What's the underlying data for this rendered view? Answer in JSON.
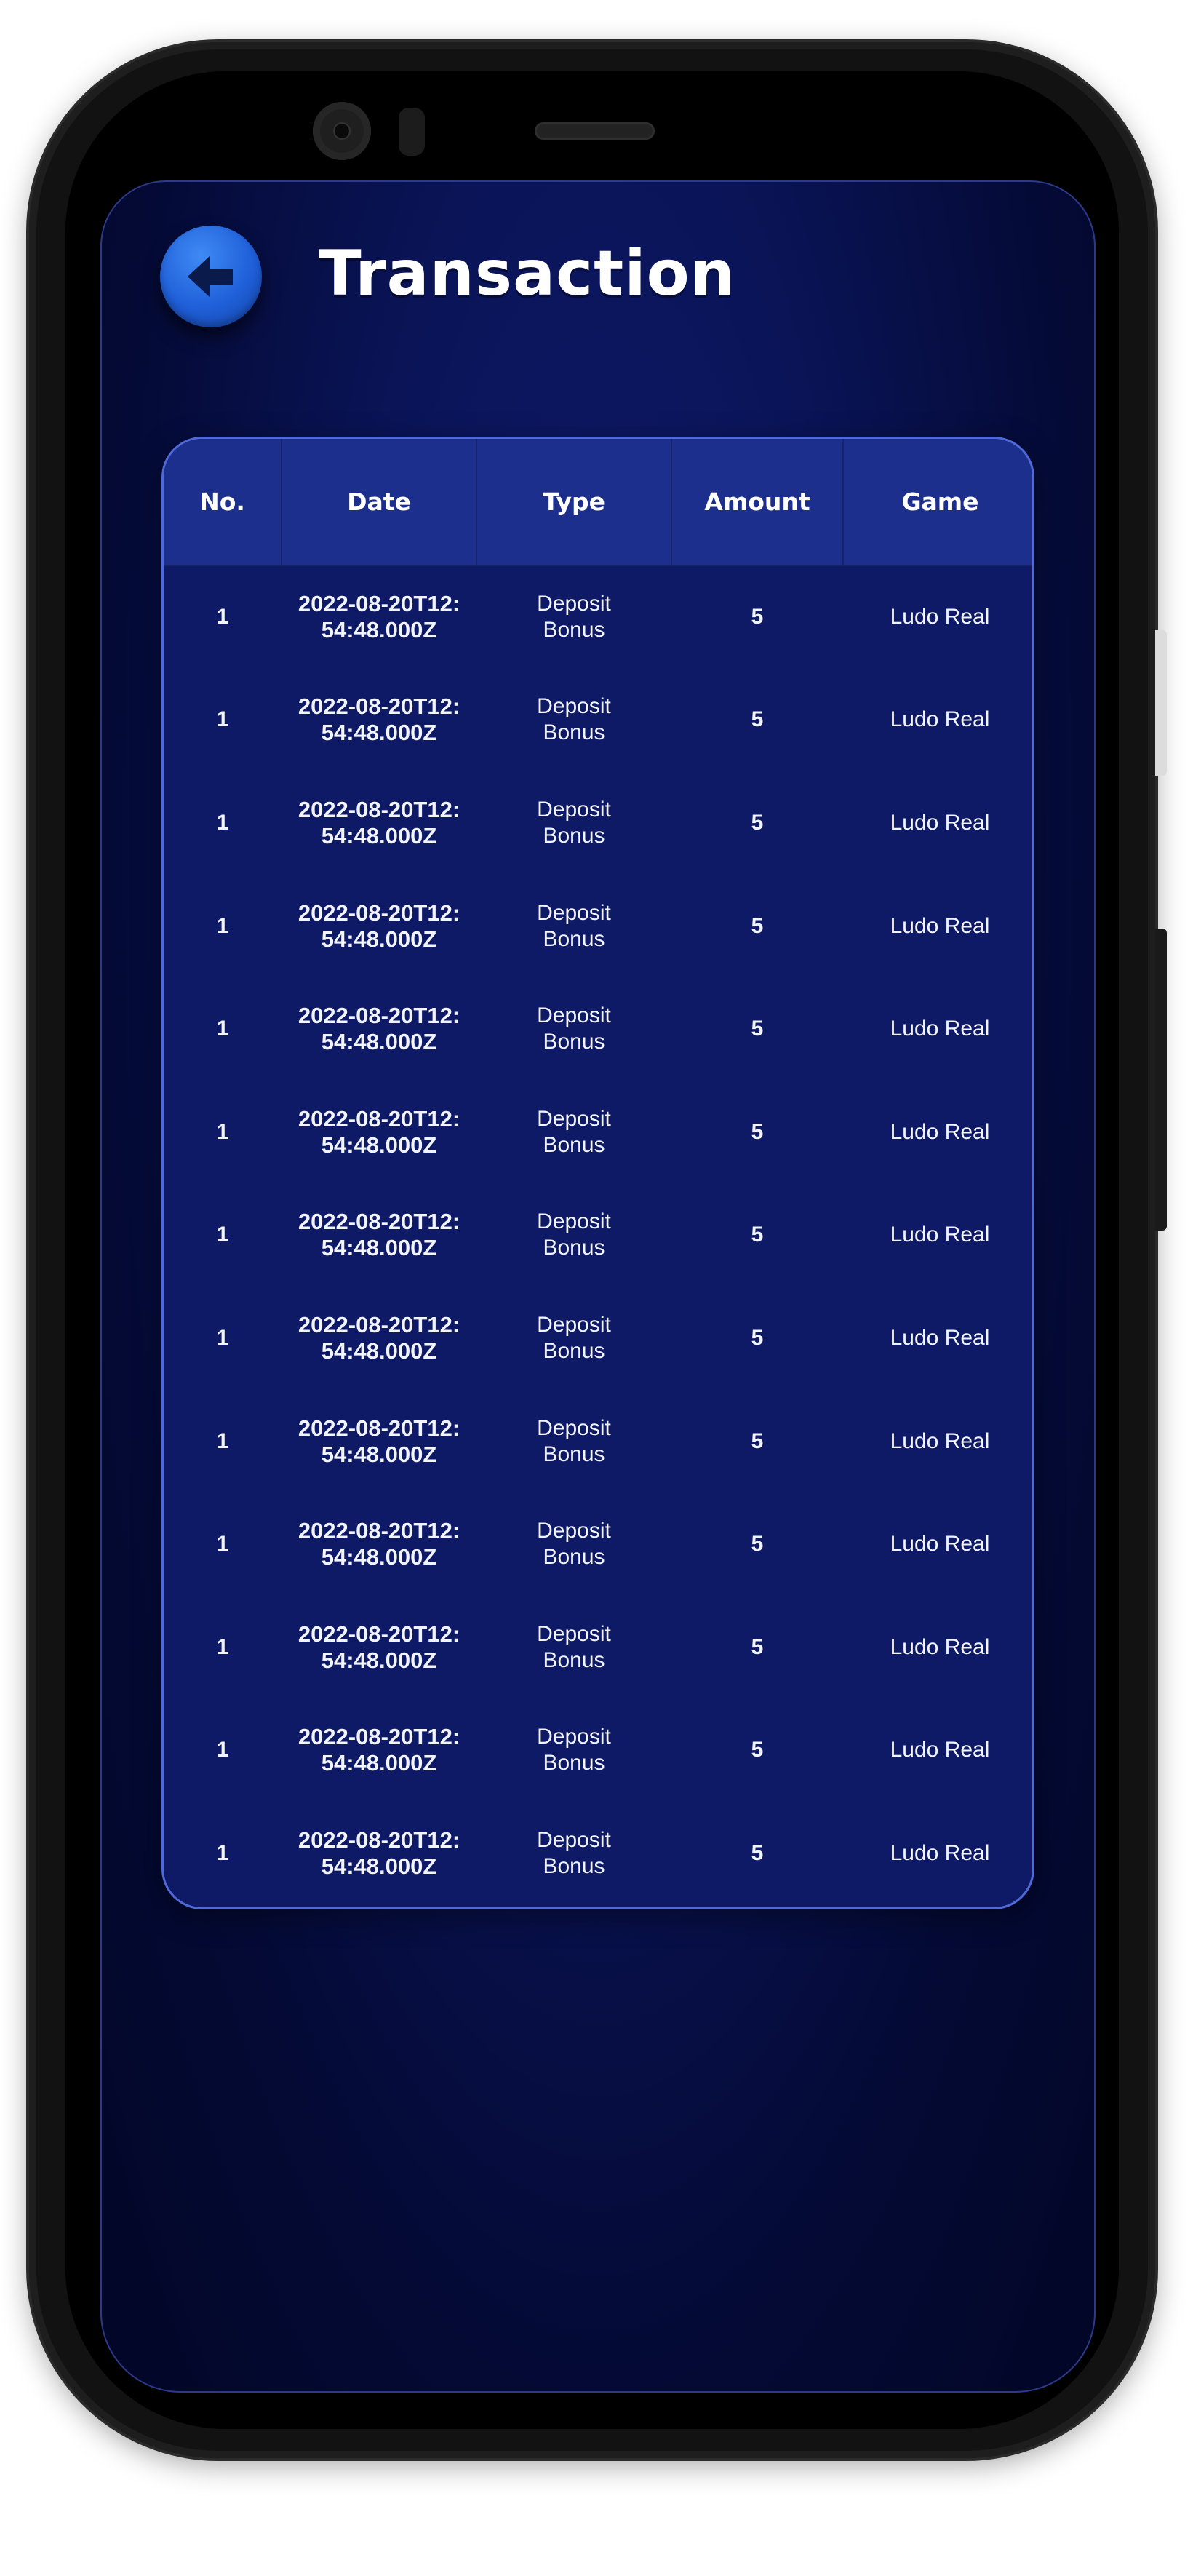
{
  "header": {
    "title": "Transaction",
    "back_icon": "arrow-left-icon"
  },
  "table": {
    "columns": [
      "No.",
      "Date",
      "Type",
      "Amount",
      "Game"
    ],
    "rows": [
      {
        "no": "1",
        "date_line1": "2022-08-20T12:",
        "date_line2": "54:48.000Z",
        "type_line1": "Deposit",
        "type_line2": "Bonus",
        "amount": "5",
        "game": "Ludo Real"
      },
      {
        "no": "1",
        "date_line1": "2022-08-20T12:",
        "date_line2": "54:48.000Z",
        "type_line1": "Deposit",
        "type_line2": "Bonus",
        "amount": "5",
        "game": "Ludo Real"
      },
      {
        "no": "1",
        "date_line1": "2022-08-20T12:",
        "date_line2": "54:48.000Z",
        "type_line1": "Deposit",
        "type_line2": "Bonus",
        "amount": "5",
        "game": "Ludo Real"
      },
      {
        "no": "1",
        "date_line1": "2022-08-20T12:",
        "date_line2": "54:48.000Z",
        "type_line1": "Deposit",
        "type_line2": "Bonus",
        "amount": "5",
        "game": "Ludo Real"
      },
      {
        "no": "1",
        "date_line1": "2022-08-20T12:",
        "date_line2": "54:48.000Z",
        "type_line1": "Deposit",
        "type_line2": "Bonus",
        "amount": "5",
        "game": "Ludo Real"
      },
      {
        "no": "1",
        "date_line1": "2022-08-20T12:",
        "date_line2": "54:48.000Z",
        "type_line1": "Deposit",
        "type_line2": "Bonus",
        "amount": "5",
        "game": "Ludo Real"
      },
      {
        "no": "1",
        "date_line1": "2022-08-20T12:",
        "date_line2": "54:48.000Z",
        "type_line1": "Deposit",
        "type_line2": "Bonus",
        "amount": "5",
        "game": "Ludo Real"
      },
      {
        "no": "1",
        "date_line1": "2022-08-20T12:",
        "date_line2": "54:48.000Z",
        "type_line1": "Deposit",
        "type_line2": "Bonus",
        "amount": "5",
        "game": "Ludo Real"
      },
      {
        "no": "1",
        "date_line1": "2022-08-20T12:",
        "date_line2": "54:48.000Z",
        "type_line1": "Deposit",
        "type_line2": "Bonus",
        "amount": "5",
        "game": "Ludo Real"
      },
      {
        "no": "1",
        "date_line1": "2022-08-20T12:",
        "date_line2": "54:48.000Z",
        "type_line1": "Deposit",
        "type_line2": "Bonus",
        "amount": "5",
        "game": "Ludo Real"
      },
      {
        "no": "1",
        "date_line1": "2022-08-20T12:",
        "date_line2": "54:48.000Z",
        "type_line1": "Deposit",
        "type_line2": "Bonus",
        "amount": "5",
        "game": "Ludo Real"
      },
      {
        "no": "1",
        "date_line1": "2022-08-20T12:",
        "date_line2": "54:48.000Z",
        "type_line1": "Deposit",
        "type_line2": "Bonus",
        "amount": "5",
        "game": "Ludo Real"
      },
      {
        "no": "1",
        "date_line1": "2022-08-20T12:",
        "date_line2": "54:48.000Z",
        "type_line1": "Deposit",
        "type_line2": "Bonus",
        "amount": "5",
        "game": "Ludo Real"
      }
    ]
  },
  "colors": {
    "background": "#0a1457",
    "header_row": "#1d2f8c",
    "card_border": "#4f6ad8",
    "back_button": "#1f5fd8",
    "text": "#ffffff"
  }
}
